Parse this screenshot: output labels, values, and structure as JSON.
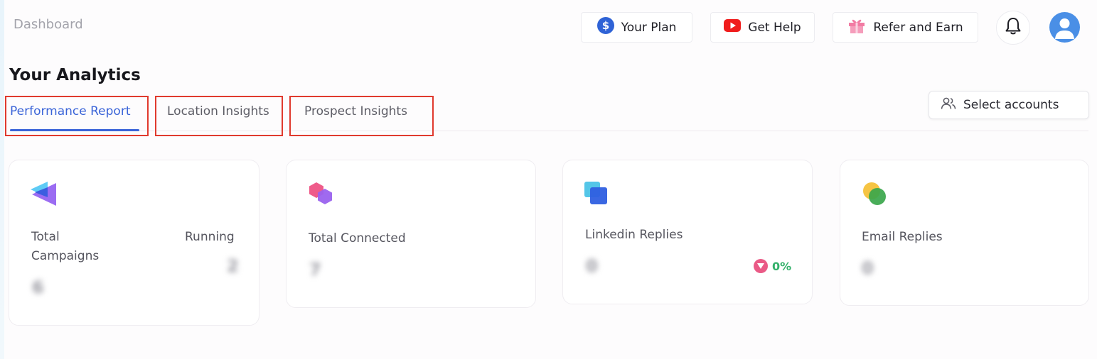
{
  "header": {
    "breadcrumb": "Dashboard",
    "buttons": {
      "plan_label": "Your Plan",
      "help_label": "Get Help",
      "refer_label": "Refer and Earn"
    }
  },
  "page": {
    "title": "Your Analytics"
  },
  "tabs": [
    {
      "label": "Performance Report",
      "active": true
    },
    {
      "label": "Location Insights",
      "active": false
    },
    {
      "label": "Prospect Insights",
      "active": false
    }
  ],
  "select_accounts": {
    "label": "Select accounts"
  },
  "cards": [
    {
      "label_line1": "Total",
      "label_line2": "Campaigns",
      "value": "6",
      "secondary_label": "Running",
      "secondary_value": "2"
    },
    {
      "label": "Total Connected",
      "value": "7"
    },
    {
      "label": "Linkedin Replies",
      "value": "0",
      "delta": "0%"
    },
    {
      "label": "Email Replies",
      "value": "0"
    }
  ],
  "colors": {
    "accent": "#3a64d8",
    "highlight_border": "#e03a2e",
    "positive": "#33b06a"
  },
  "icons": {
    "plan": "dollar-circle-icon",
    "help": "youtube-icon",
    "refer": "gift-icon",
    "notifications": "bell-icon",
    "user": "avatar-icon",
    "accounts": "users-icon"
  }
}
